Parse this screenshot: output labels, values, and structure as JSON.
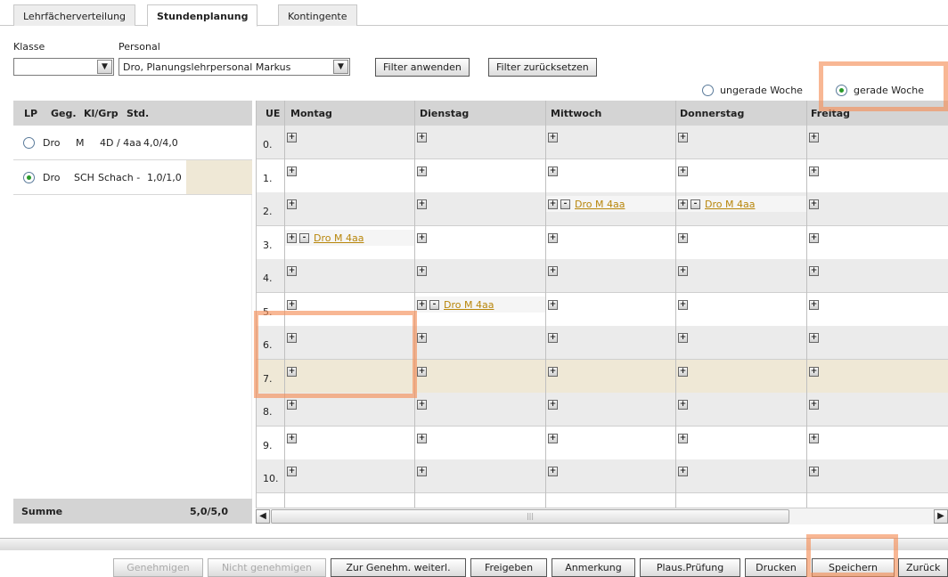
{
  "tabs": [
    "Lehrfächerverteilung",
    "Stundenplanung",
    "Kontingente"
  ],
  "filter": {
    "klasse_label": "Klasse",
    "klasse_value": "",
    "personal_label": "Personal",
    "personal_value": "Dro, Planungslehrpersonal Markus",
    "apply_label": "Filter anwenden",
    "reset_label": "Filter zurücksetzen"
  },
  "week": {
    "odd_label": "ungerade Woche",
    "even_label": "gerade Woche",
    "selected": "even"
  },
  "lp_table": {
    "headers": [
      "LP",
      "Geg.",
      "Kl/Grp",
      "Std."
    ],
    "rows": [
      {
        "lp": "Dro",
        "geg": "M",
        "klgrp": "4D / 4aa",
        "std": "4,0/4,0",
        "selected": false
      },
      {
        "lp": "Dro",
        "geg": "SCH",
        "klgrp": "Schach -",
        "std": "1,0/1,0",
        "selected": true
      }
    ],
    "sum_label": "Summe",
    "sum_value": "5,0/5,0"
  },
  "schedule": {
    "headers": [
      "UE",
      "Montag",
      "Dienstag",
      "Mittwoch",
      "Donnerstag",
      "Freitag"
    ],
    "rows": [
      {
        "ue": "0.",
        "cells": [
          "",
          "",
          "",
          "",
          ""
        ]
      },
      {
        "ue": "1.",
        "cells": [
          "",
          "",
          "",
          "",
          ""
        ]
      },
      {
        "ue": "2.",
        "cells": [
          "",
          "",
          "Dro M 4aa",
          "Dro M 4aa",
          ""
        ]
      },
      {
        "ue": "3.",
        "cells": [
          "Dro M 4aa",
          "",
          "",
          "",
          ""
        ]
      },
      {
        "ue": "4.",
        "cells": [
          "",
          "",
          "",
          "",
          ""
        ]
      },
      {
        "ue": "5.",
        "cells": [
          "",
          "Dro M 4aa",
          "",
          "",
          ""
        ]
      },
      {
        "ue": "6.",
        "cells": [
          "",
          "",
          "",
          "",
          ""
        ]
      },
      {
        "ue": "7.",
        "cells": [
          "",
          "",
          "",
          "",
          ""
        ]
      },
      {
        "ue": "8.",
        "cells": [
          "",
          "",
          "",
          "",
          ""
        ]
      },
      {
        "ue": "9.",
        "cells": [
          "",
          "",
          "",
          "",
          ""
        ]
      },
      {
        "ue": "10.",
        "cells": [
          "",
          "",
          "",
          "",
          ""
        ]
      }
    ],
    "plus": "+",
    "minus": "-"
  },
  "actions": [
    "Genehmigen",
    "Nicht genehmigen",
    "Zur Genehm. weiterl.",
    "Freigeben",
    "Anmerkung",
    "Plaus.Prüfung",
    "Drucken",
    "Speichern",
    "Zurück"
  ],
  "actions_disabled": [
    0,
    1
  ],
  "icons": {
    "dropdown": "chevron-down-icon",
    "scroll_left": "arrow-left-icon",
    "scroll_right": "arrow-right-icon"
  }
}
